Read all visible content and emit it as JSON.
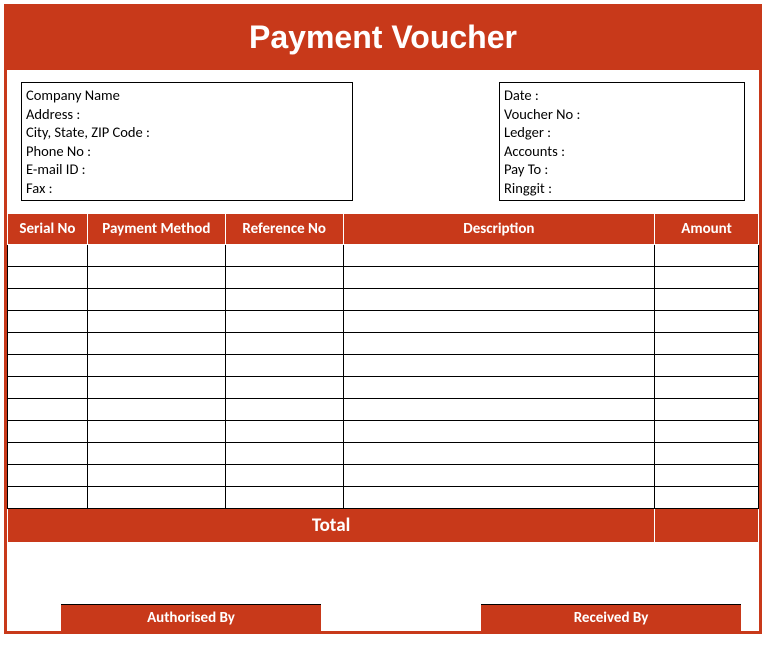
{
  "title": "Payment Voucher",
  "company_box": {
    "line1": "Company Name",
    "line2": "Address :",
    "line3": "City, State, ZIP Code :",
    "line4": "Phone No :",
    "line5": "E-mail ID :",
    "line6": "Fax :"
  },
  "details_box": {
    "line1": "Date :",
    "line2": "Voucher No :",
    "line3": "Ledger :",
    "line4": "Accounts :",
    "line5": "Pay To :",
    "line6": "Ringgit :"
  },
  "columns": {
    "serial": "Serial No",
    "method": "Payment Method",
    "ref": "Reference No",
    "desc": "Description",
    "amount": "Amount"
  },
  "total_label": "Total",
  "signatures": {
    "authorised": "Authorised By",
    "received": "Received By"
  },
  "row_count": 12
}
